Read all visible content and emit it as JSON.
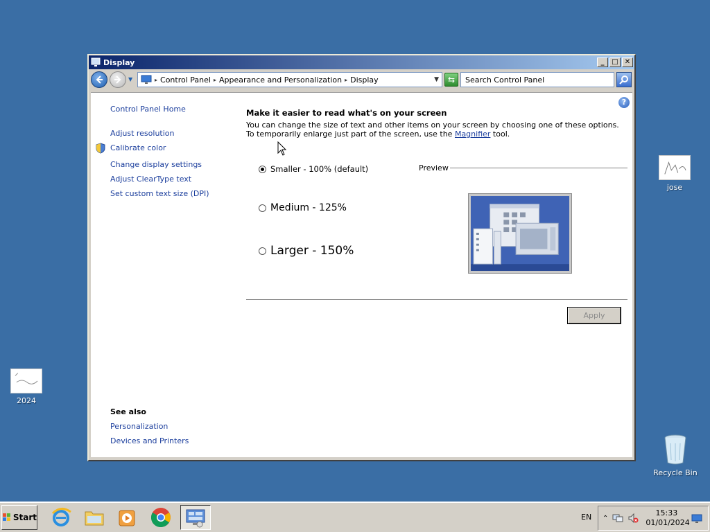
{
  "desktop": {
    "icons": [
      {
        "label": "jose"
      },
      {
        "label": "2024"
      },
      {
        "label": "Recycle Bin"
      }
    ]
  },
  "window": {
    "title": "Display",
    "controls": {
      "minimize": "_",
      "maximize": "□",
      "close": "✕"
    },
    "address": {
      "crumbs": [
        "Control Panel",
        "Appearance and Personalization",
        "Display"
      ]
    },
    "search": {
      "placeholder": "Search Control Panel"
    },
    "help": "?"
  },
  "left_pane": {
    "links": [
      "Control Panel Home",
      "Adjust resolution",
      "Calibrate color",
      "Change display settings",
      "Adjust ClearType text",
      "Set custom text size (DPI)"
    ],
    "see_also_title": "See also",
    "see_also": [
      "Personalization",
      "Devices and Printers"
    ]
  },
  "main": {
    "heading": "Make it easier to read what's on your screen",
    "desc_before": "You can change the size of text and other items on your screen by choosing one of these options. To temporarily enlarge just part of the screen, use the ",
    "desc_link": "Magnifier",
    "desc_after": " tool.",
    "options": [
      {
        "label": "Smaller - 100% (default)",
        "selected": true
      },
      {
        "label": "Medium - 125%",
        "selected": false
      },
      {
        "label": "Larger - 150%",
        "selected": false
      }
    ],
    "preview_label": "Preview",
    "apply_label": "Apply"
  },
  "taskbar": {
    "start_label": "Start",
    "language": "EN",
    "time": "15:33",
    "date": "01/01/2024"
  }
}
